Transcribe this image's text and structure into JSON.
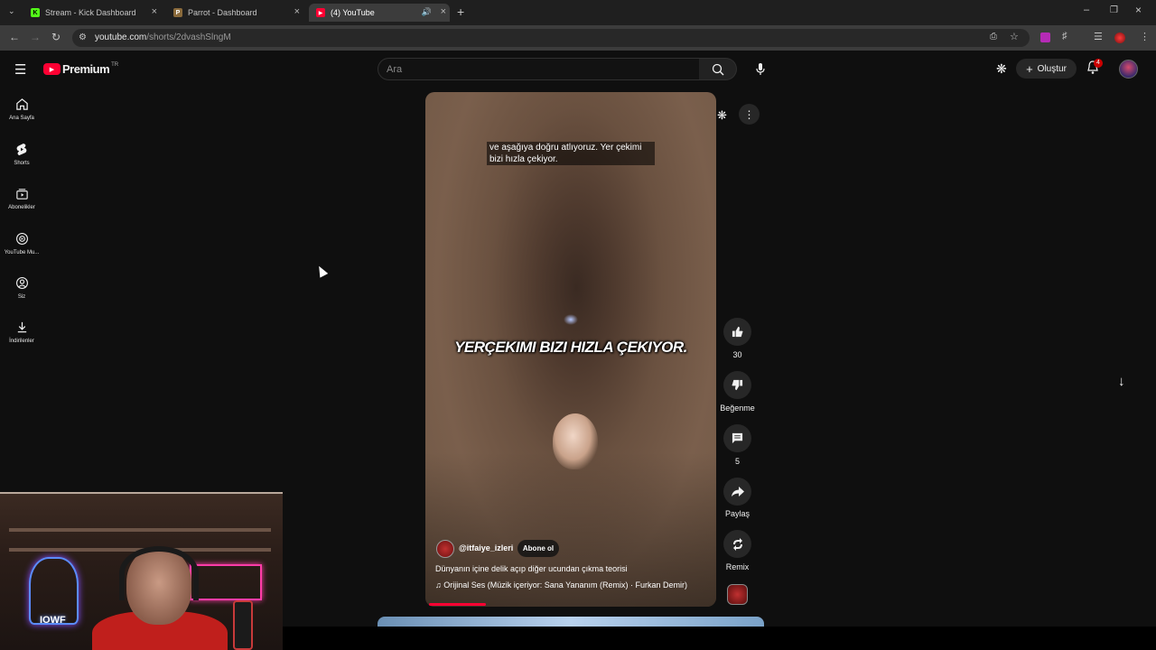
{
  "browser": {
    "tabs": [
      {
        "title": "Stream - Kick Dashboard",
        "favicon": "K",
        "favicon_color": "#53fc18"
      },
      {
        "title": "Parrot - Dashboard",
        "favicon": "P",
        "favicon_color": "#8a6a3b"
      },
      {
        "title": "(4) YouTube",
        "favicon": "▶",
        "favicon_color": "#ff0033"
      }
    ],
    "url_host": "youtube.com",
    "url_path": "/shorts/2dvashSlngM"
  },
  "header": {
    "logo_text": "Premium",
    "region_code": "TR",
    "search_placeholder": "Ara",
    "create_label": "Oluştur",
    "notification_count": "4"
  },
  "sidebar": {
    "items": [
      {
        "label": "Ana Sayfa",
        "icon": "home-icon"
      },
      {
        "label": "Shorts",
        "icon": "shorts-icon"
      },
      {
        "label": "Abonelikler",
        "icon": "subscriptions-icon"
      },
      {
        "label": "YouTube Mu...",
        "icon": "music-icon"
      },
      {
        "label": "Siz",
        "icon": "you-icon"
      },
      {
        "label": "İndirilenler",
        "icon": "download-icon"
      }
    ]
  },
  "video": {
    "caption_top": "ve aşağıya doğru atlıyoruz. Yer çekimi bizi hızla çekiyor.",
    "caption_big": "YERÇEKIMI BIZI HIZLA ÇEKIYOR.",
    "channel": "@itfaiye_izleri",
    "subscribe_label": "Abone ol",
    "title": "Dünyanın içine delik açıp diğer ucundan çıkma teorisi",
    "music": "Orijinal Ses (Müzik içeriyor: Sana Yananım (Remix) · Furkan Demir)",
    "progress": 0.2
  },
  "actions": {
    "like_count": "30",
    "dislike_label": "Beğenme",
    "comment_count": "5",
    "share_label": "Paylaş",
    "remix_label": "Remix"
  },
  "webcam": {
    "neon_text": "IOWF"
  },
  "colors": {
    "background": "#0f0f0f",
    "accent": "#ff0033",
    "chip": "#272727"
  }
}
